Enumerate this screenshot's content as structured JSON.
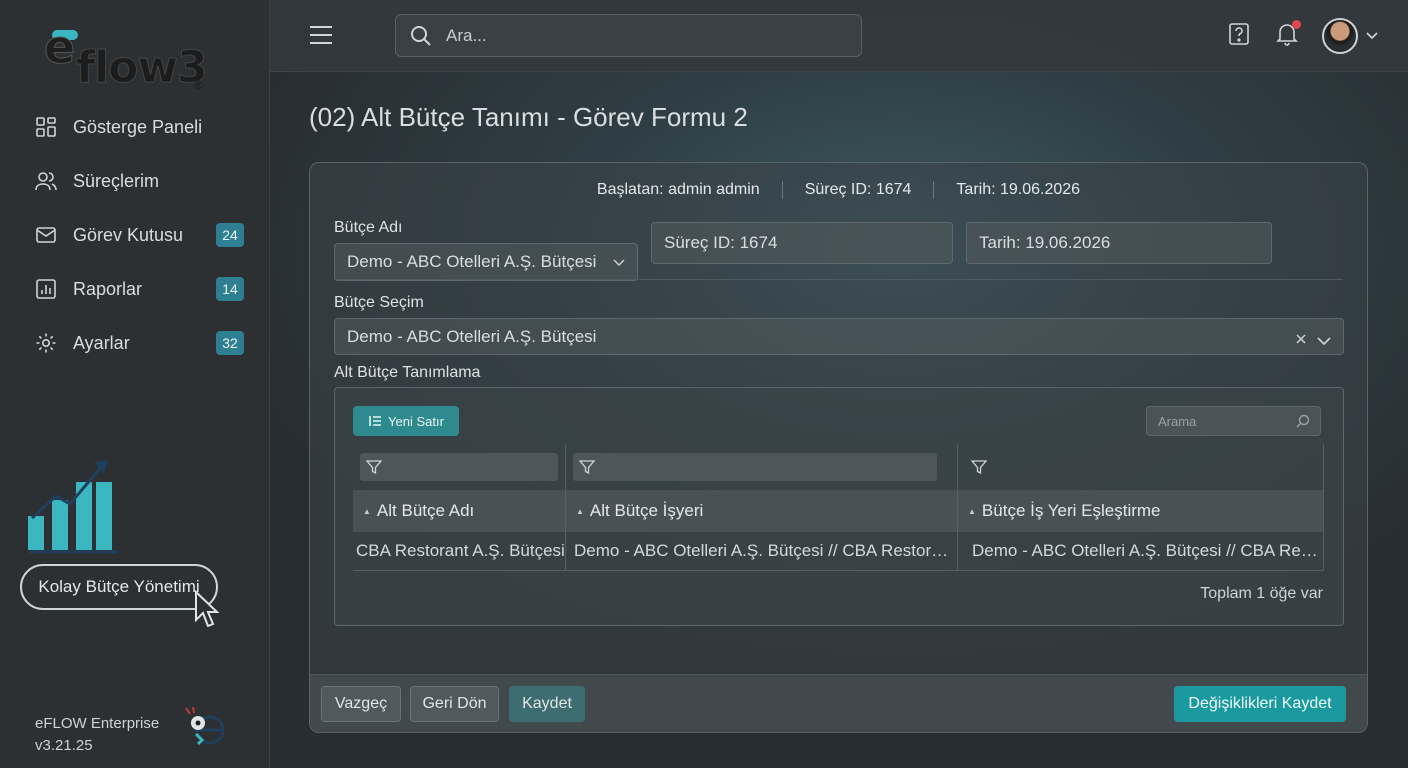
{
  "colors": {
    "accent": "#1a9a9e",
    "badge": "#2f7f93",
    "sidebar": "#2c3033"
  },
  "brand": {
    "logo_text": "eflow3"
  },
  "sidebar": {
    "items": [
      {
        "label": "Gösterge Paneli",
        "icon": "dashboard-icon",
        "badge": ""
      },
      {
        "label": "Süreçlerim",
        "icon": "users-icon",
        "badge": ""
      },
      {
        "label": "Görev Kutusu",
        "icon": "mail-icon",
        "badge": "24"
      },
      {
        "label": "Raporlar",
        "icon": "report-icon",
        "badge": "14"
      },
      {
        "label": "Ayarlar",
        "icon": "gear-icon",
        "badge": "32"
      }
    ],
    "promo_text": "Kolay Bütçe Yönetimi",
    "version_name": "eFLOW Enterprise",
    "version_number": "v3.21.25"
  },
  "topbar": {
    "search_placeholder": "Ara..."
  },
  "page": {
    "title": "(02) Alt Bütçe Tanımı - Görev Formu 2"
  },
  "meta": {
    "started_by_label": "Başlatan:",
    "started_by": "admin admin",
    "process_id_label": "Süreç ID:",
    "process_id": "1674",
    "date_label": "Tarih:",
    "date": "19.06.2026"
  },
  "form": {
    "budget_name_label": "Bütçe Adı",
    "budget_name_value": "Demo -  ABC Otelleri A.Ş. Bütçesi",
    "process_id_field": "Süreç ID:  1674",
    "date_field": "Tarih:  19.06.2026",
    "budget_select_label": "Bütçe Seçim",
    "budget_select_value": "Demo -  ABC Otelleri A.Ş. Bütçesi",
    "sub_budget_label": "Alt Bütçe Tanımlama"
  },
  "grid": {
    "new_row_label": "Yeni Satır",
    "search_placeholder": "Arama",
    "columns": [
      "Alt Bütçe Adı",
      "Alt Bütçe İşyeri",
      "Bütçe İş Yeri Eşleştirme"
    ],
    "rows": [
      [
        "CBA Restorant A.Ş. Bütçesi",
        "Demo -  ABC Otelleri A.Ş. Bütçesi // CBA Restorant...",
        "Demo -  ABC Otelleri A.Ş. Bütçesi // CBA Restor..."
      ]
    ],
    "total_text": "Toplam 1 öğe var"
  },
  "footer": {
    "cancel_label": "Vazgeç",
    "back_label": "Geri Dön",
    "save_label": "Kaydet",
    "save_changes_label": "Değişiklikleri Kaydet"
  }
}
